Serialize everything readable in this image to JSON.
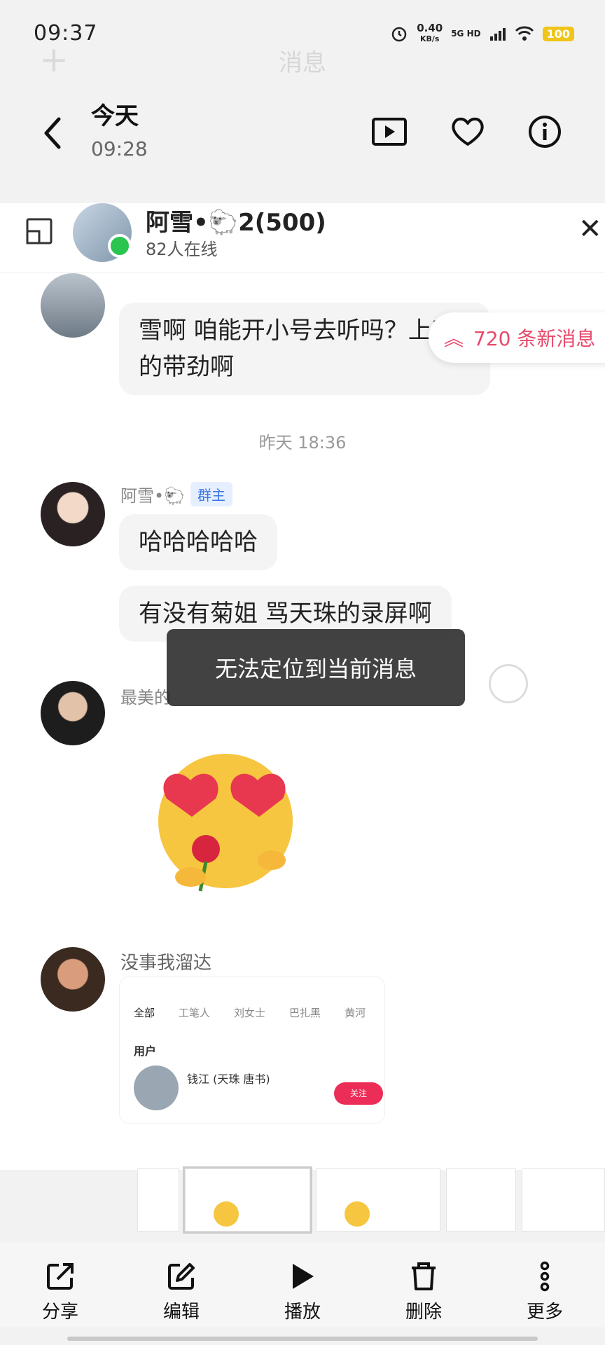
{
  "status_bar": {
    "time": "09:37",
    "speed_value": "0.40",
    "speed_unit": "KB/s",
    "network": "5G HD",
    "battery": "100"
  },
  "background_app": {
    "title": "消息"
  },
  "viewer": {
    "date_title": "今天",
    "date_time": "09:28"
  },
  "chat": {
    "group_name": "阿雪•🐑2(500)",
    "online_count": "82人在线",
    "new_messages": "720 条新消息",
    "messages": [
      {
        "name": "",
        "text": "雪啊 咱能开小号去听吗？上听的带劲啊"
      },
      {
        "name": "阿雪•🐑",
        "badge": "群主",
        "text": "哈哈哈哈哈"
      },
      {
        "name": "",
        "text": "有没有菊姐 骂天珠的录屏啊"
      },
      {
        "name": "最美的",
        "text": ""
      },
      {
        "name": "没事我溜达",
        "text": ""
      }
    ],
    "timestamp": "昨天 18:36",
    "toast": "无法定位到当前消息",
    "mini_card": {
      "tabs": [
        "全部",
        "工笔人",
        "刘女士",
        "巴扎黑",
        "黄河"
      ],
      "section": "用户",
      "user_name": "钱江 (天珠 唐书)",
      "follow": "关注"
    }
  },
  "toolbar": {
    "share": "分享",
    "edit": "编辑",
    "play": "播放",
    "delete": "删除",
    "more": "更多"
  },
  "colors": {
    "accent_pink": "#e84a6b",
    "online_green": "#2bc44f",
    "owner_blue": "#3a75e6",
    "battery_yellow": "#f0c419"
  }
}
